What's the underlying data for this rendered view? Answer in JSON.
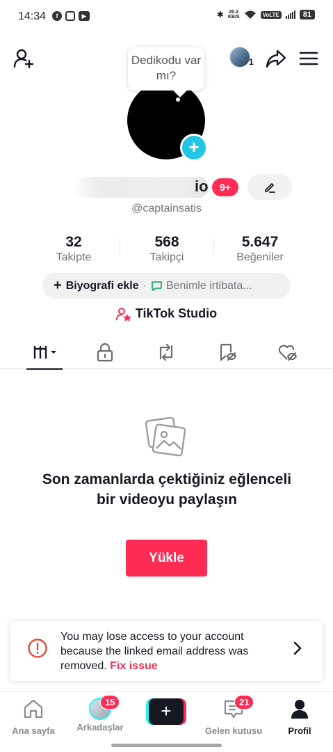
{
  "status_bar": {
    "time": "14:34",
    "speed_top": "20.2",
    "speed_unit": "KB/S",
    "volte": "VoLTE",
    "battery": "81"
  },
  "header": {
    "bubble_text": "Dedikodu var mı?",
    "top_avatar_count": "1"
  },
  "profile": {
    "username_suffix": "io",
    "notification_badge": "9+",
    "handle": "@captainsatis"
  },
  "stats": [
    {
      "value": "32",
      "label": "Takipte"
    },
    {
      "value": "568",
      "label": "Takipçi"
    },
    {
      "value": "5.647",
      "label": "Beğeniler"
    }
  ],
  "bio": {
    "add_label": "Biyografi ekle",
    "contact_label": "Benimle irtibata..."
  },
  "studio_label": "TikTok Studio",
  "tabs": [
    "videos",
    "private",
    "reposts",
    "favorites",
    "liked"
  ],
  "empty_state": {
    "title": "Son zamanlarda çektiğiniz eğlenceli bir videoyu paylaşın",
    "button_label": "Yükle"
  },
  "warning": {
    "text": "You may lose access to your account because the linked email address was removed.",
    "fix_label": "Fix issue"
  },
  "bottom_nav": {
    "home": "Ana sayfa",
    "friends": "Arkadaşlar",
    "friends_badge": "15",
    "inbox": "Gelen kutusu",
    "inbox_badge": "21",
    "profile": "Profil"
  },
  "colors": {
    "accent": "#fe2c55",
    "cyan": "#20c6e4",
    "text": "#161823",
    "muted": "#73757c"
  }
}
